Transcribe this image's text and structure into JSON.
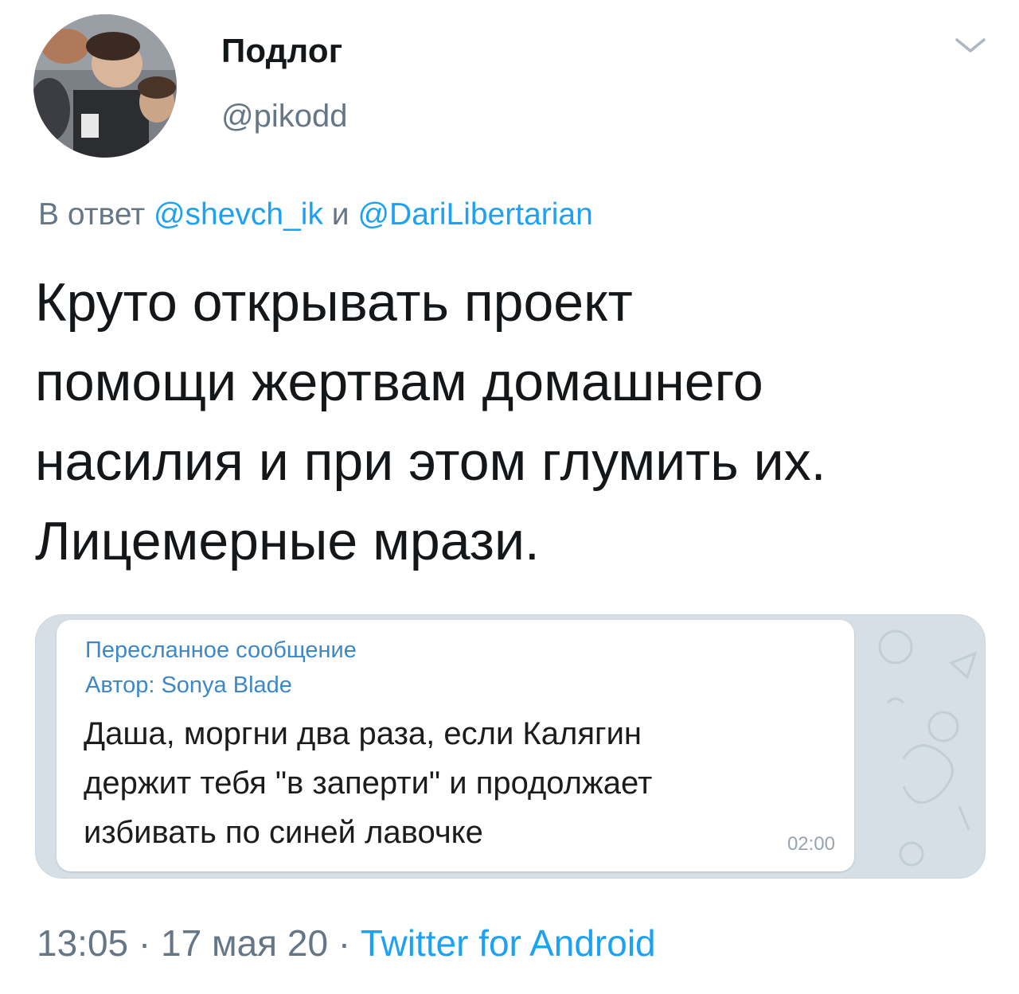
{
  "author": {
    "display_name": "Подлог",
    "handle": "@pikodd",
    "avatar_icon": "user-avatar"
  },
  "reply": {
    "prefix": "В ответ",
    "mention1": "@shevch_ik",
    "conjunction": "и",
    "mention2": "@DariLibertarian"
  },
  "tweet": {
    "lines": [
      "Круто открывать проект",
      "помощи жертвам домашнего",
      "насилия и при этом глумить их.",
      "Лицемерные мрази."
    ]
  },
  "media": {
    "forwarded_title": "Пересланное сообщение",
    "forwarded_author": "Автор: Sonya Blade",
    "message_lines": [
      "Даша, моргни два раза, если Калягин",
      "держит тебя \"в заперти\" и продолжает",
      "избивать по синей лавочке"
    ],
    "message_time": "02:00"
  },
  "footer": {
    "time": "13:05",
    "separator1": " · ",
    "date": "17 мая 20",
    "separator2": " · ",
    "source": "Twitter for Android"
  },
  "colors": {
    "link": "#1da1f2",
    "secondary_text": "#657786",
    "primary_text": "#14171a",
    "telegram_accent": "#3d88c5"
  }
}
